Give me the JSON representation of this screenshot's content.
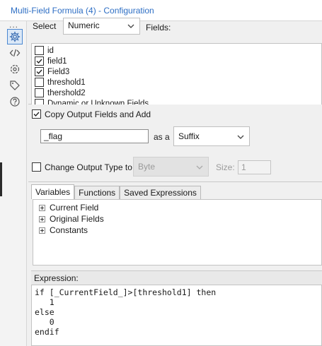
{
  "window": {
    "title": "Multi-Field Formula (4) - Configuration"
  },
  "sidebar": {
    "more": "...",
    "icons": [
      "gear-icon",
      "code-icon",
      "target-icon",
      "tag-icon",
      "help-icon"
    ]
  },
  "select_section": {
    "select_label": "Select",
    "select_value": "Numeric",
    "fields_label": "Fields:",
    "fields": [
      {
        "name": "id",
        "checked": false
      },
      {
        "name": "field1",
        "checked": true
      },
      {
        "name": "Field3",
        "checked": true
      },
      {
        "name": "threshold1",
        "checked": false
      },
      {
        "name": "thershold2",
        "checked": false
      },
      {
        "name": "Dynamic or Unknown Fields",
        "checked": false
      }
    ]
  },
  "output_section": {
    "copy_label": "Copy Output Fields and Add",
    "copy_checked": true,
    "suffix_value": "_flag",
    "as_a_label": "as a",
    "position_value": "Suffix",
    "change_type_label": "Change Output Type to",
    "change_type_checked": false,
    "type_value": "Byte",
    "size_label": "Size:",
    "size_value": "1"
  },
  "formula_section": {
    "tabs": [
      "Variables",
      "Functions",
      "Saved Expressions"
    ],
    "active_tab": "Variables",
    "tree": [
      "Current Field",
      "Original Fields",
      "Constants"
    ],
    "expression_label": "Expression:",
    "expression_lines": [
      "if [_CurrentField_]>[threshold1] then",
      "   1",
      "else",
      "   0",
      "endif"
    ]
  },
  "colors": {
    "title": "#2d6ec4",
    "active_icon_border": "#4a87d1"
  }
}
